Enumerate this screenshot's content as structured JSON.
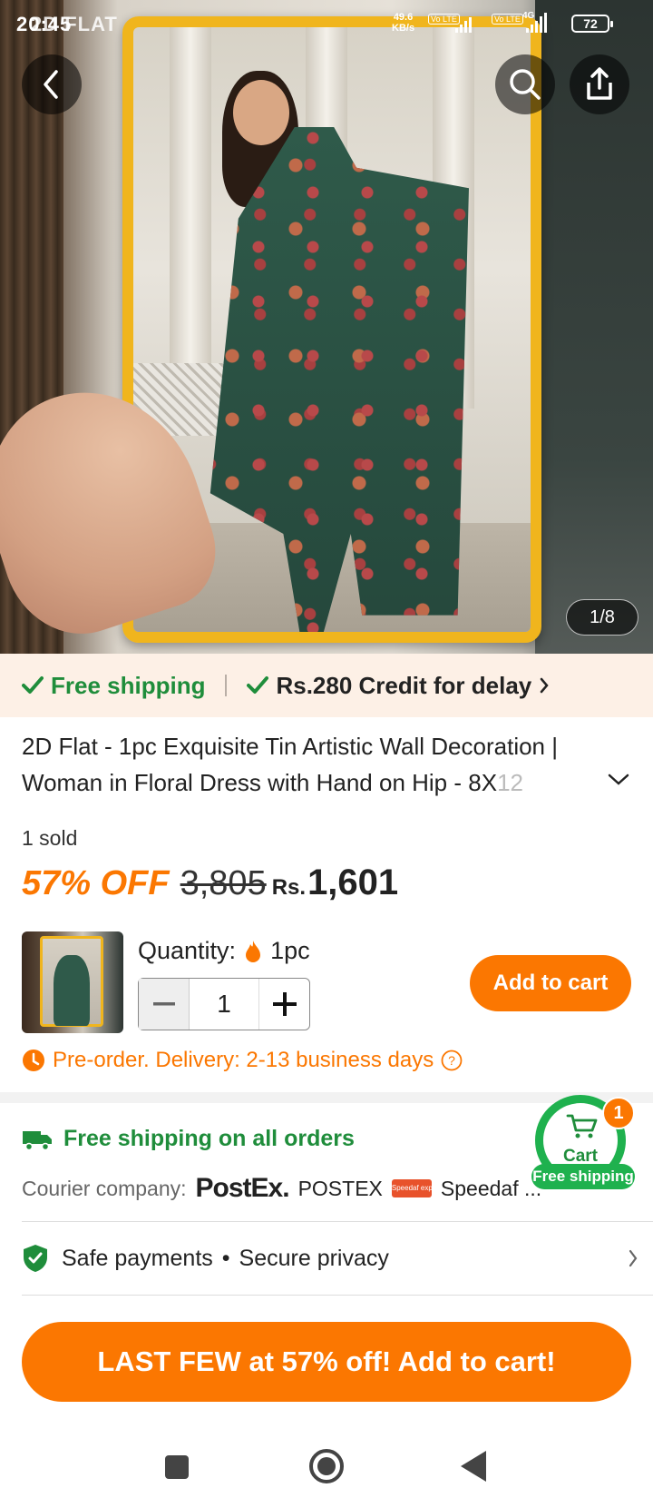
{
  "status_bar": {
    "time": "20:45",
    "carrier_overlay": "2D FLAT",
    "net_speed_value": "49.6",
    "net_speed_unit": "KB/s",
    "volte_label": "Vo LTE",
    "signal2_label": "4G",
    "battery": "72"
  },
  "hero": {
    "image_counter": "1/8",
    "back_icon": "chevron-left-icon",
    "search_icon": "search-icon",
    "share_icon": "share-icon"
  },
  "shipping_banner": {
    "free_shipping": "Free shipping",
    "credit": "Rs.280 Credit for delay"
  },
  "product": {
    "title_main": "2D Flat - 1pc Exquisite Tin Artistic Wall Decoration | Woman in Floral Dress with Hand on Hip - 8X",
    "title_faded": "12",
    "sold": "1 sold",
    "discount": "57% OFF",
    "original_price": "3,805",
    "currency": "Rs.",
    "price": "1,601"
  },
  "purchase": {
    "quantity_label": "Quantity:",
    "quantity_unit": "1pc",
    "quantity_value": "1",
    "add_to_cart": "Add to cart",
    "preorder": "Pre-order. Delivery: 2-13 business days"
  },
  "delivery": {
    "free_shipping_all": "Free shipping on all orders",
    "courier_label": "Courier company:",
    "courier_logo": "PostEx.",
    "courier_1": "POSTEX",
    "courier_2_logo": "Speedaf express",
    "courier_2": "Speedaf ..."
  },
  "cart_float": {
    "label": "Cart",
    "badge_count": "1",
    "pill": "Free shipping"
  },
  "safety": {
    "safe_payments": "Safe payments",
    "separator": "•",
    "secure_privacy": "Secure privacy"
  },
  "cta": {
    "label": "LAST FEW at 57% off! Add to cart!"
  },
  "colors": {
    "accent_orange": "#fb7701",
    "green": "#1f8d3b",
    "frame_yellow": "#f0b51d",
    "banner_bg": "#fdf0e6"
  }
}
